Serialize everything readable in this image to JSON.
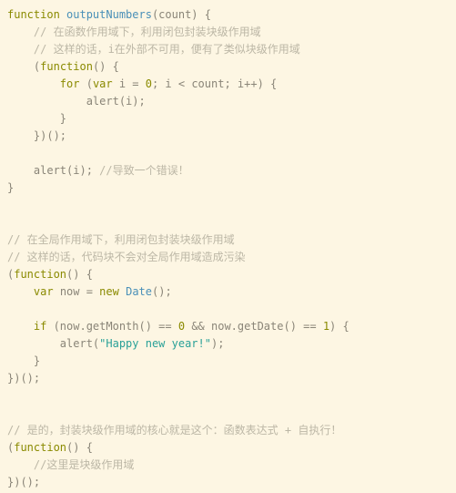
{
  "editor": {
    "language": "javascript",
    "theme_name": "solarized-light",
    "background_color": "#fdf6e3",
    "font_size_px": 12,
    "line_height_px": 19,
    "indent_width_spaces": 4,
    "total_lines": 28
  },
  "colors": {
    "keyword": "#8a8a00",
    "function_name": "#4a90b8",
    "type_name": "#4a90b8",
    "string": "#2aa198",
    "number": "#8a8a00",
    "comment": "#bcb7a6",
    "punctuation": "#8a8578",
    "identifier": "#8a8578"
  },
  "code": {
    "lines": [
      {
        "n": 1,
        "indent": 0,
        "tokens": [
          {
            "t": "function",
            "c": "kw"
          },
          {
            "t": " ",
            "c": "pun"
          },
          {
            "t": "outputNumbers",
            "c": "fn"
          },
          {
            "t": "(count) {",
            "c": "pun"
          }
        ]
      },
      {
        "n": 2,
        "indent": 1,
        "tokens": [
          {
            "t": "// 在函数作用域下，利用闭包封装块级作用域",
            "c": "com"
          }
        ]
      },
      {
        "n": 3,
        "indent": 1,
        "tokens": [
          {
            "t": "// 这样的话，i在外部不可用，便有了类似块级作用域",
            "c": "com"
          }
        ]
      },
      {
        "n": 4,
        "indent": 1,
        "tokens": [
          {
            "t": "(",
            "c": "pun"
          },
          {
            "t": "function",
            "c": "kw"
          },
          {
            "t": "() {",
            "c": "pun"
          }
        ]
      },
      {
        "n": 5,
        "indent": 2,
        "tokens": [
          {
            "t": "for",
            "c": "kw"
          },
          {
            "t": " (",
            "c": "pun"
          },
          {
            "t": "var",
            "c": "kw"
          },
          {
            "t": " i = ",
            "c": "pun"
          },
          {
            "t": "0",
            "c": "num"
          },
          {
            "t": "; i < count; i++) {",
            "c": "pun"
          }
        ]
      },
      {
        "n": 6,
        "indent": 3,
        "tokens": [
          {
            "t": "alert(i);",
            "c": "pun"
          }
        ]
      },
      {
        "n": 7,
        "indent": 2,
        "tokens": [
          {
            "t": "}",
            "c": "pun"
          }
        ]
      },
      {
        "n": 8,
        "indent": 1,
        "tokens": [
          {
            "t": "})();",
            "c": "pun"
          }
        ]
      },
      {
        "n": 9,
        "indent": 0,
        "tokens": []
      },
      {
        "n": 10,
        "indent": 1,
        "tokens": [
          {
            "t": "alert(i); ",
            "c": "pun"
          },
          {
            "t": "//导致一个错误！",
            "c": "com"
          }
        ]
      },
      {
        "n": 11,
        "indent": 0,
        "tokens": [
          {
            "t": "}",
            "c": "pun"
          }
        ]
      },
      {
        "n": 12,
        "indent": 0,
        "tokens": []
      },
      {
        "n": 13,
        "indent": 0,
        "tokens": []
      },
      {
        "n": 14,
        "indent": 0,
        "tokens": [
          {
            "t": "// 在全局作用域下，利用闭包封装块级作用域",
            "c": "com"
          }
        ]
      },
      {
        "n": 15,
        "indent": 0,
        "tokens": [
          {
            "t": "// 这样的话，代码块不会对全局作用域造成污染",
            "c": "com"
          }
        ]
      },
      {
        "n": 16,
        "indent": 0,
        "tokens": [
          {
            "t": "(",
            "c": "pun"
          },
          {
            "t": "function",
            "c": "kw"
          },
          {
            "t": "() {",
            "c": "pun"
          }
        ]
      },
      {
        "n": 17,
        "indent": 1,
        "tokens": [
          {
            "t": "var",
            "c": "kw"
          },
          {
            "t": " now = ",
            "c": "pun"
          },
          {
            "t": "new",
            "c": "kw"
          },
          {
            "t": " ",
            "c": "pun"
          },
          {
            "t": "Date",
            "c": "type"
          },
          {
            "t": "();",
            "c": "pun"
          }
        ]
      },
      {
        "n": 18,
        "indent": 0,
        "tokens": []
      },
      {
        "n": 19,
        "indent": 1,
        "tokens": [
          {
            "t": "if",
            "c": "kw"
          },
          {
            "t": " (now.getMonth() == ",
            "c": "pun"
          },
          {
            "t": "0",
            "c": "num"
          },
          {
            "t": " && now.getDate() == ",
            "c": "pun"
          },
          {
            "t": "1",
            "c": "num"
          },
          {
            "t": ") {",
            "c": "pun"
          }
        ]
      },
      {
        "n": 20,
        "indent": 2,
        "tokens": [
          {
            "t": "alert(",
            "c": "pun"
          },
          {
            "t": "\"Happy new year!\"",
            "c": "str"
          },
          {
            "t": ");",
            "c": "pun"
          }
        ]
      },
      {
        "n": 21,
        "indent": 1,
        "tokens": [
          {
            "t": "}",
            "c": "pun"
          }
        ]
      },
      {
        "n": 22,
        "indent": 0,
        "tokens": [
          {
            "t": "})();",
            "c": "pun"
          }
        ]
      },
      {
        "n": 23,
        "indent": 0,
        "tokens": []
      },
      {
        "n": 24,
        "indent": 0,
        "tokens": []
      },
      {
        "n": 25,
        "indent": 0,
        "tokens": [
          {
            "t": "// 是的，封装块级作用域的核心就是这个：函数表达式 + 自执行！",
            "c": "com"
          }
        ]
      },
      {
        "n": 26,
        "indent": 0,
        "tokens": [
          {
            "t": "(",
            "c": "pun"
          },
          {
            "t": "function",
            "c": "kw"
          },
          {
            "t": "() {",
            "c": "pun"
          }
        ]
      },
      {
        "n": 27,
        "indent": 1,
        "tokens": [
          {
            "t": "//这里是块级作用域",
            "c": "com"
          }
        ]
      },
      {
        "n": 28,
        "indent": 0,
        "tokens": [
          {
            "t": "})();",
            "c": "pun"
          }
        ]
      }
    ]
  }
}
